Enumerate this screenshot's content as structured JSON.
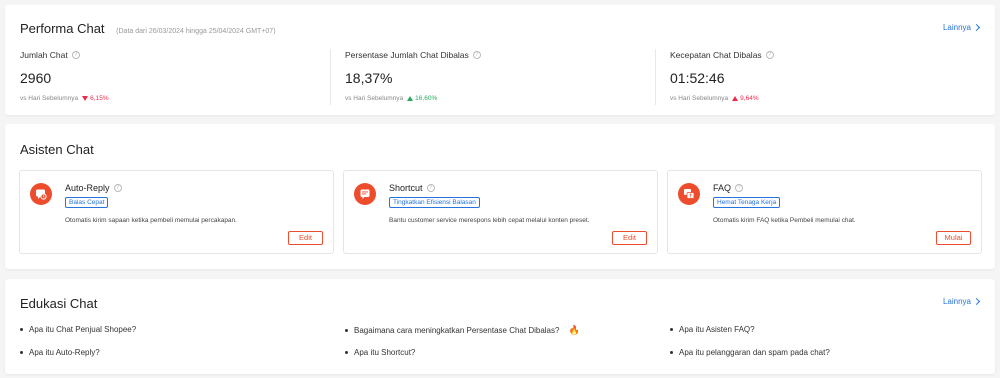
{
  "performance": {
    "title": "Performa Chat",
    "date_note": "(Data dari 26/03/2024 hingga 25/04/2024 GMT+07)",
    "more_label": "Lainnya",
    "metrics": [
      {
        "label": "Jumlah Chat",
        "value": "2960",
        "compare": "vs Hari Sebelumnya",
        "delta": "6,15%",
        "direction": "down"
      },
      {
        "label": "Persentase Jumlah Chat Dibalas",
        "value": "18,37%",
        "compare": "vs Hari Sebelumnya",
        "delta": "16,60%",
        "direction": "up-green"
      },
      {
        "label": "Kecepatan Chat Dibalas",
        "value": "01:52:46",
        "compare": "vs Hari Sebelumnya",
        "delta": "9,64%",
        "direction": "up-red"
      }
    ]
  },
  "assistant": {
    "title": "Asisten Chat",
    "tools": [
      {
        "name": "Auto-Reply",
        "tag": "Balas Cepat",
        "desc": "Otomatis kirim sapaan ketika pembeli memulai percakapan.",
        "button": "Edit",
        "icon": "auto-reply-icon"
      },
      {
        "name": "Shortcut",
        "tag": "Tingkatkan Efisiensi Balasan",
        "desc": "Bantu customer service merespons lebih cepat melalui konten preset.",
        "button": "Edit",
        "icon": "shortcut-icon"
      },
      {
        "name": "FAQ",
        "tag": "Hemat Tenaga Kerja",
        "desc": "Otomatis kirim FAQ ketika Pembeli memulai chat.",
        "button": "Mulai",
        "icon": "faq-icon"
      }
    ]
  },
  "education": {
    "title": "Edukasi Chat",
    "more_label": "Lainnya",
    "items": [
      "Apa itu Chat Penjual Shopee?",
      "Bagaimana cara meningkatkan Persentase Chat Dibalas?",
      "Apa itu Asisten FAQ?",
      "Apa itu Auto-Reply?",
      "Apa itu Shortcut?",
      "Apa itu pelanggaran dan spam pada chat?"
    ]
  },
  "colors": {
    "accent": "#ee4d2d",
    "link": "#2673dd",
    "down": "#ee2c4a",
    "up": "#26aa63"
  }
}
